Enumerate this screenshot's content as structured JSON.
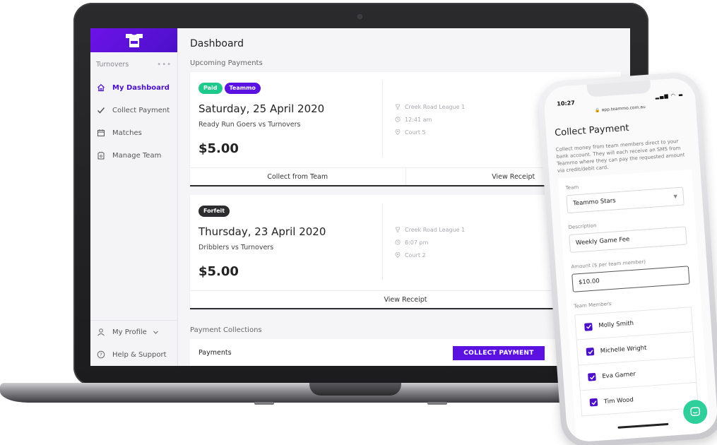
{
  "app": {
    "team_name": "Turnovers",
    "more_dots": "•••"
  },
  "sidebar": {
    "items": [
      {
        "label": "My Dashboard",
        "icon": "home-icon",
        "active": true
      },
      {
        "label": "Collect Payment",
        "icon": "checkmark-icon",
        "active": false
      },
      {
        "label": "Matches",
        "icon": "calendar-icon",
        "active": false
      },
      {
        "label": "Manage Team",
        "icon": "team-icon",
        "active": false
      }
    ],
    "bottom": {
      "profile_label": "My Profile",
      "help_label": "Help & Support"
    }
  },
  "main": {
    "title": "Dashboard",
    "upcoming_title": "Upcoming Payments",
    "cards": [
      {
        "badges": [
          "Paid",
          "Teammo"
        ],
        "date": "Saturday, 25 April 2020",
        "match": "Ready Run Goers vs Turnovers",
        "amount": "$5.00",
        "league": "Creek Road League 1",
        "time": "12:41 am",
        "court": "Court 5",
        "actions": [
          "Collect from Team",
          "View Receipt"
        ]
      },
      {
        "badges": [
          "Forfeit"
        ],
        "date": "Thursday, 23 April 2020",
        "match": "Dribblers vs Turnovers",
        "amount": "$5.00",
        "league": "Creek Road League 1",
        "time": "6:07 pm",
        "court": "Court 2",
        "actions": [
          "View Receipt"
        ]
      }
    ],
    "collections_title": "Payment Collections",
    "payments_label": "Payments",
    "collect_button": "COLLECT PAYMENT"
  },
  "phone": {
    "time": "10:27",
    "status": "▂▄▆ ◠ ▬",
    "url": "🔒 app.teammo.com.au",
    "title": "Collect Payment",
    "description": "Collect money from team members direct to your bank account. They will each receive an SMS from Teammo where they can pay the requested amount via credit/debit card.",
    "team_label": "Team",
    "team_value": "Teammo Stars",
    "description_label": "Description",
    "description_value": "Weekly Game Fee",
    "amount_label": "Amount ($ per team member)",
    "amount_value": "$10.00",
    "members_label": "Team Members",
    "members": [
      "Molly Smith",
      "Michelle Wright",
      "Eva Garner",
      "Tim Wood"
    ]
  },
  "colors": {
    "brand_purple": "#5b12e0",
    "paid_green": "#1ec98b",
    "forfeit_dark": "#2d2d30",
    "chat_green": "#2ecf9a"
  }
}
